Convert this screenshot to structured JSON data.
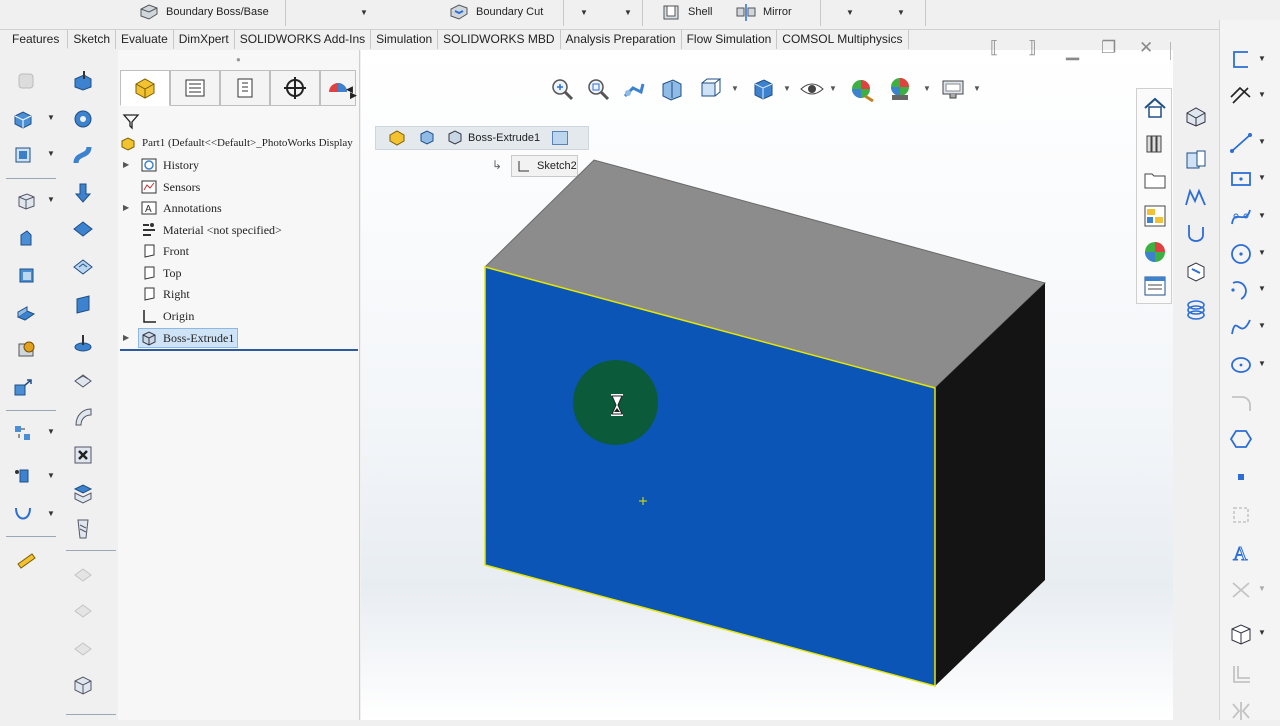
{
  "toolbar": {
    "boundary_boss_label": "Boundary Boss/Base",
    "boundary_cut_label": "Boundary Cut",
    "shell_label": "Shell",
    "mirror_label": "Mirror"
  },
  "tabs": [
    {
      "label": "Features"
    },
    {
      "label": "Sketch"
    },
    {
      "label": "Evaluate"
    },
    {
      "label": "DimXpert"
    },
    {
      "label": "SOLIDWORKS Add-Ins"
    },
    {
      "label": "Simulation"
    },
    {
      "label": "SOLIDWORKS MBD"
    },
    {
      "label": "Analysis Preparation"
    },
    {
      "label": "Flow Simulation"
    },
    {
      "label": "COMSOL Multiphysics"
    }
  ],
  "tree": {
    "root": "Part1  (Default<<Default>_PhotoWorks Display",
    "items": [
      {
        "label": "History"
      },
      {
        "label": "Sensors"
      },
      {
        "label": "Annotations"
      },
      {
        "label": "Material <not specified>"
      },
      {
        "label": "Front"
      },
      {
        "label": "Top"
      },
      {
        "label": "Right"
      },
      {
        "label": "Origin"
      },
      {
        "label": "Boss-Extrude1"
      }
    ]
  },
  "breadcrumb": {
    "feature": "Boss-Extrude1",
    "sketch": "Sketch2"
  },
  "colors": {
    "selected_face": "#0a55b5",
    "top_face": "#8c8c8c",
    "side_face": "#141414",
    "edge_highlight": "#e6e600",
    "busy_indicator": "#0b5a3a"
  },
  "icons": {
    "busy": "hourglass-icon"
  }
}
